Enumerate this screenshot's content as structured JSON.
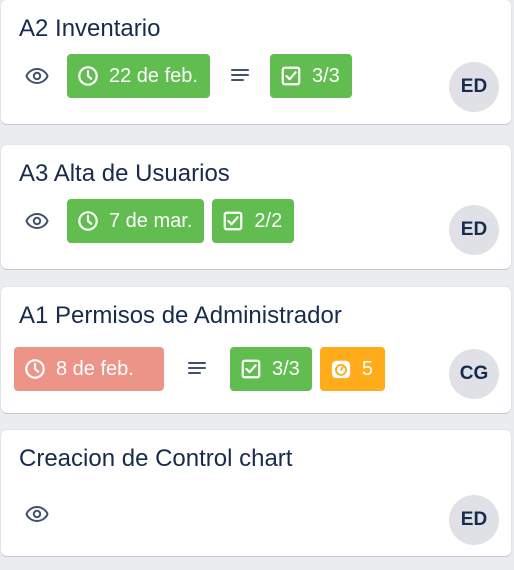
{
  "cards": [
    {
      "title": "A2 Inventario",
      "due": "22 de feb.",
      "checklist": "3/3",
      "avatar": "ED",
      "icons": [
        "eye-icon",
        "clock-icon",
        "description-icon",
        "checklist-icon"
      ]
    },
    {
      "title": "A3 Alta de Usuarios",
      "due": "7 de mar.",
      "checklist": "2/2",
      "avatar": "ED",
      "icons": [
        "eye-icon",
        "clock-icon",
        "checklist-icon"
      ]
    },
    {
      "title": "A1 Permisos de Administrador",
      "due": "8 de feb.",
      "checklist": "3/3",
      "points": "5",
      "avatar": "CG",
      "icons": [
        "clock-icon",
        "description-icon",
        "checklist-icon",
        "stopwatch-icon"
      ]
    },
    {
      "title": "Creacion de Control chart",
      "avatar": "ED",
      "icons": [
        "eye-icon"
      ]
    }
  ],
  "colors": {
    "green": "#61bd4f",
    "overdue_red": "#ec9488",
    "orange": "#ffab1a",
    "avatar_bg": "#dfe1e6",
    "board_bg": "#ebecf0"
  }
}
